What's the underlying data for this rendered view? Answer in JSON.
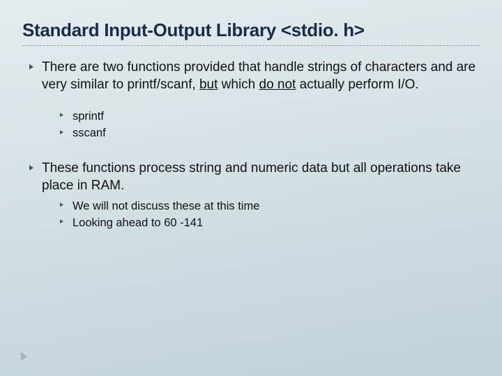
{
  "title": "Standard Input-Output Library <stdio. h>",
  "bullets": [
    {
      "pre": "There are two functions provided that handle strings of characters and are very similar to printf/scanf, ",
      "u1": "but",
      "mid": " which ",
      "u2": "do not",
      "post": " actually perform I/O.",
      "sub": [
        {
          "text": "sprintf"
        },
        {
          "text": "sscanf"
        }
      ]
    },
    {
      "text": "These functions process string and numeric data but all operations take place in RAM.",
      "sub": [
        {
          "text": "We will not discuss these at this time"
        },
        {
          "text": "Looking ahead to 60 -141"
        }
      ]
    }
  ]
}
